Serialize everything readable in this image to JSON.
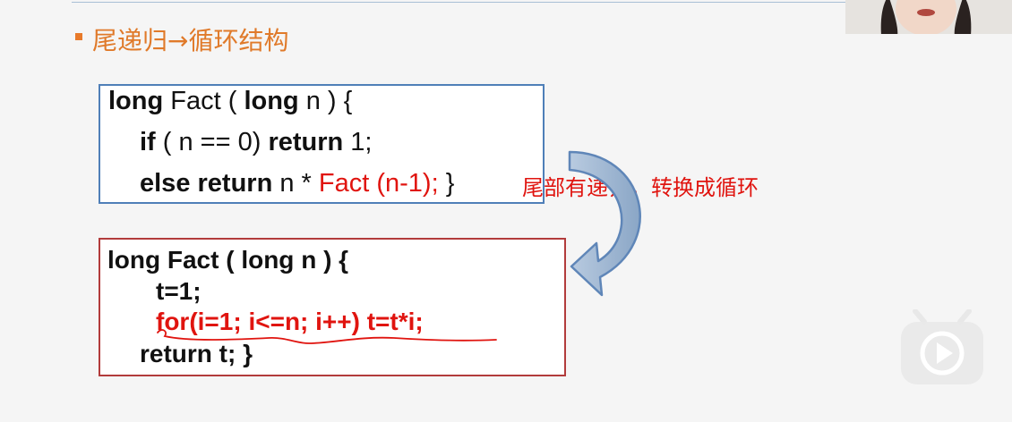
{
  "slide": {
    "heading": "尾递归→循环结构",
    "annotation": "尾部有递归，转换成循环"
  },
  "code_box_1": {
    "line1": {
      "kw1": "long",
      "t1": " Fact ( ",
      "kw2": "long",
      "t2": " n ) {"
    },
    "line2": {
      "kw1": "if",
      "t1": " ( n  == 0) ",
      "kw2": "return",
      "t2": " 1;"
    },
    "line3": {
      "kw1": "else return",
      "t1": " n * ",
      "red1": "Fact (n-1);",
      "t2": " }"
    }
  },
  "code_box_2": {
    "line1": "long Fact ( long n ) {",
    "line2": "t=1;",
    "line3": "for(i=1; i<=n; i++)      t=t*i;",
    "line4": "return t; }"
  },
  "colors": {
    "heading": "#e07a2a",
    "accent_red": "#e0140f",
    "box1_border": "#4f7fb8",
    "box2_border": "#b23b3b"
  },
  "icons": {
    "bullet": "square-bullet-icon",
    "arrow": "curved-arrow-icon",
    "player": "play-button-icon"
  }
}
